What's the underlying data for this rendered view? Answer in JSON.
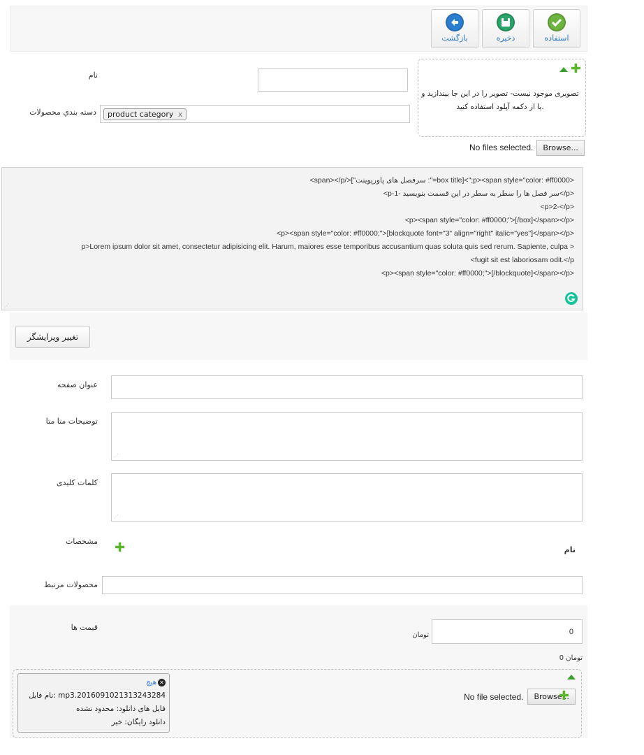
{
  "toolbar": {
    "apply_label": "استفاده",
    "save_label": "ذخیره",
    "back_label": "بازگشت"
  },
  "form": {
    "name_label": "نام",
    "name_value": "",
    "category_label": "دسته بندي محصولات",
    "category_tag": "product category",
    "tag_remove": "x"
  },
  "image_upload": {
    "dropzone_text_line1": "تصویری موجود نیست- تصویر را در این جا بیندازید و",
    "dropzone_text_line2": "یا از دکمه آپلود استفاده کنید.",
    "no_files_text": "No files selected.",
    "browse_label": "Browse..."
  },
  "editor": {
    "lines": [
      "<span></p/>[\"سرفصل های پاورپوینت :\"=box title]<\";p><span style=\"color: #ff0000>",
      "<p-1- سر فصل ها را سطر به سطر در این قسمت بنویسید</p>",
      "<p>2-</p>",
      "<p><span style=\"color: #ff0000;\">[/box]</span></p>",
      "<p><span style=\"color: #ff0000;\">[blockquote font=\"3\" align=\"right\" italic=\"yes\"]</span></p>",
      "p>Lorem ipsum dolor sit amet, consectetur adipisicing elit. Harum, maiores esse temporibus accusantium quas soluta quis sed rerum. Sapiente, culpa >",
      "<fugit sit est laboriosam odit.</p",
      "<p><span style=\"color: #ff0000;\">[/blockquote]</span></p>"
    ],
    "switch_editor_label": "تغییر ویرایشگر"
  },
  "seo": {
    "page_title_label": "عنوان صفحه",
    "meta_desc_label": "توضیحات متا متا",
    "keywords_label": "کلمات کلیدی"
  },
  "specs": {
    "label": "مشخصات",
    "column_name": "نام"
  },
  "related": {
    "label": "محصولات مرتبط"
  },
  "prices": {
    "label": "قیمت ها",
    "value": "0",
    "unit": "تومان",
    "summary": "0 تومان"
  },
  "file_upload": {
    "no_file_text": "No file selected.",
    "browse_label": "Browse...",
    "card_remove": "هیچ",
    "card_filename": "نام فایل: mp3.2016091021313243284",
    "card_downloads": "فایل های دانلود: محدود نشده",
    "card_free": "دانلود رایگان: خیر"
  },
  "colors": {
    "green_btn": "#6db33f",
    "teal_btn": "#2aa4a4",
    "blue_btn": "#2c7fd0",
    "link": "#2a77c9",
    "grammarly": "#15c39a"
  }
}
